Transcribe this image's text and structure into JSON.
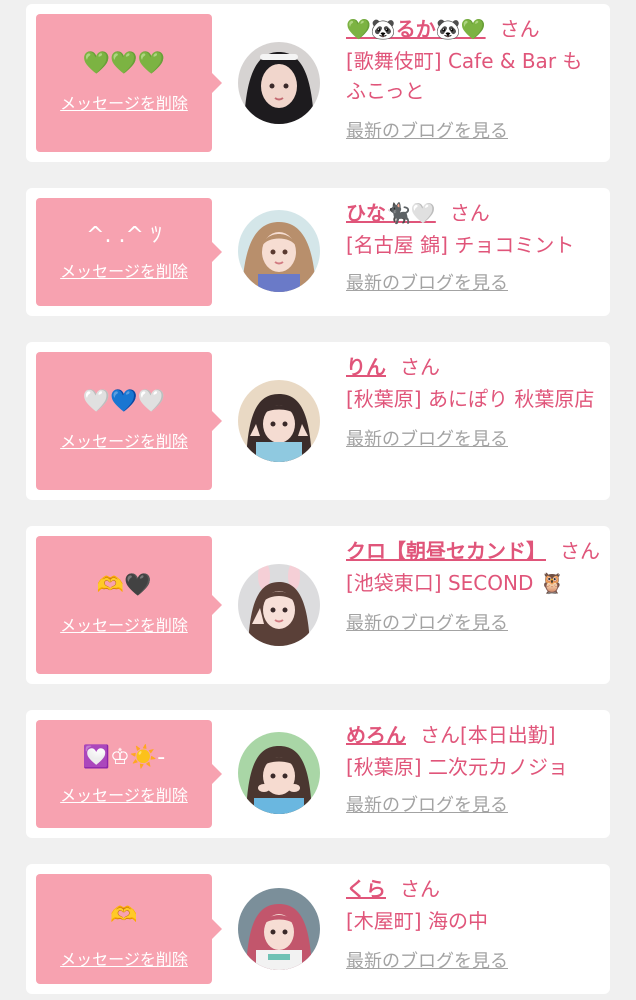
{
  "colors": {
    "accent_pink": "#e0557a",
    "bubble_pink": "#f7a2b0",
    "link_gray": "#a3a3a3",
    "page_bg": "#f0f0f0",
    "card_bg": "#ffffff"
  },
  "delete_label": "メッセージを削除",
  "san_label": "さん",
  "blog_label": "最新のブログを見る",
  "items": [
    {
      "message": "💚💚💚",
      "name": "💚🐼るか🐼💚",
      "suffix": "",
      "shop": "[歌舞伎町] Cafe & Bar もふこっと",
      "avatar_icon": "avatar-portrait-1"
    },
    {
      "message": "^. .^ ﾂ",
      "name": "ひな🐈‍⬛🤍",
      "suffix": "",
      "shop": "[名古屋 錦] チョコミント",
      "avatar_icon": "avatar-portrait-2"
    },
    {
      "message": "🤍💙🤍",
      "name": "りん",
      "suffix": "",
      "shop": "[秋葉原] あにぽり 秋葉原店",
      "avatar_icon": "avatar-portrait-3"
    },
    {
      "message": "🫶🖤",
      "name": "クロ【朝昼セカンド】",
      "suffix": "",
      "shop": "[池袋東口] SECOND 🦉",
      "avatar_icon": "avatar-portrait-4"
    },
    {
      "message": "💟♔☀️-",
      "name": "めろん",
      "suffix": "[本日出勤]",
      "shop": "[秋葉原] 二次元カノジョ",
      "avatar_icon": "avatar-portrait-5"
    },
    {
      "message": "🫶",
      "name": "くら",
      "suffix": "",
      "shop": "[木屋町] 海の中",
      "avatar_icon": "avatar-portrait-6"
    }
  ]
}
